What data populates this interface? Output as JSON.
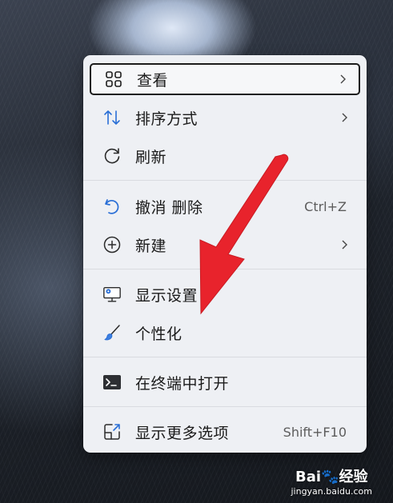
{
  "menu": {
    "items": [
      {
        "label": "查看",
        "icon": "grid-icon",
        "submenu": true,
        "focused": true
      },
      {
        "label": "排序方式",
        "icon": "sort-icon",
        "submenu": true
      },
      {
        "label": "刷新",
        "icon": "refresh-icon"
      },
      {
        "label": "撤消 删除",
        "icon": "undo-icon",
        "shortcut": "Ctrl+Z"
      },
      {
        "label": "新建",
        "icon": "new-plus-icon",
        "submenu": true
      },
      {
        "label": "显示设置",
        "icon": "display-settings-icon"
      },
      {
        "label": "个性化",
        "icon": "paintbrush-icon"
      },
      {
        "label": "在终端中打开",
        "icon": "terminal-icon"
      },
      {
        "label": "显示更多选项",
        "icon": "more-options-icon",
        "shortcut": "Shift+F10"
      }
    ]
  },
  "watermark": {
    "logo": "Bai🐾经验",
    "url": "jingyan.baidu.com"
  },
  "colors": {
    "annotation_arrow": "#e8232c",
    "accent_blue": "#2a6fd6",
    "menu_bg": "#eef0f4"
  }
}
